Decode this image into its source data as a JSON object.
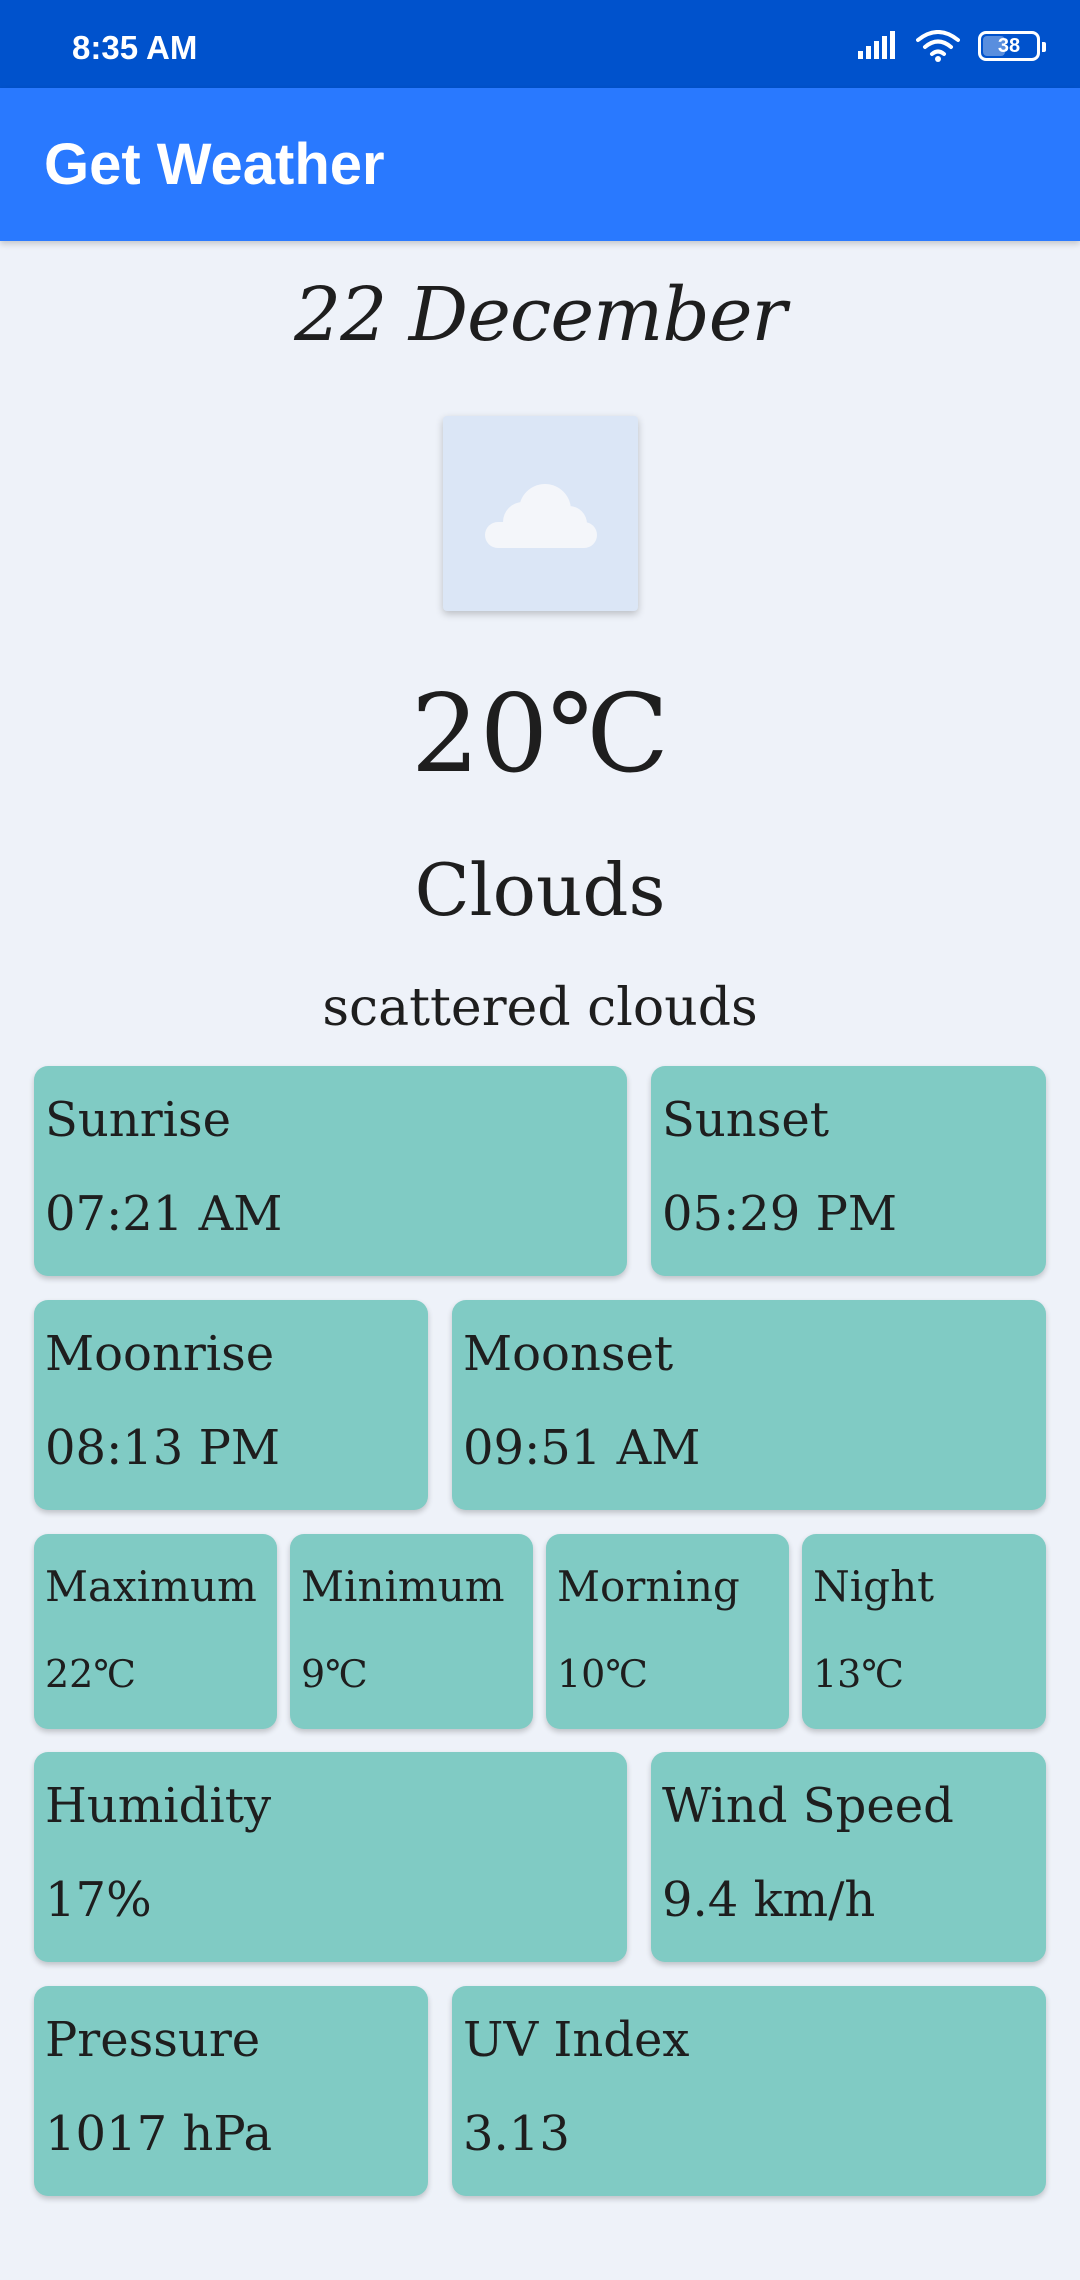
{
  "status_bar": {
    "time": "8:35 AM",
    "battery": "38",
    "icons": [
      "signal-icon",
      "wifi-icon",
      "battery-icon"
    ]
  },
  "app_bar": {
    "title": "Get Weather"
  },
  "weather": {
    "date": "22 December",
    "icon": "cloud-icon",
    "temperature": "20℃",
    "main": "Clouds",
    "description": "scattered clouds"
  },
  "cards": {
    "sunrise": {
      "label": "Sunrise",
      "value": "07:21 AM"
    },
    "sunset": {
      "label": "Sunset",
      "value": "05:29 PM"
    },
    "moonrise": {
      "label": "Moonrise",
      "value": "08:13 PM"
    },
    "moonset": {
      "label": "Moonset",
      "value": "09:51 AM"
    },
    "maximum": {
      "label": "Maximum",
      "value": "22℃"
    },
    "minimum": {
      "label": "Minimum",
      "value": "9℃"
    },
    "morning": {
      "label": "Morning",
      "value": "10℃"
    },
    "night": {
      "label": "Night",
      "value": "13℃"
    },
    "humidity": {
      "label": "Humidity",
      "value": "17%"
    },
    "wind_speed": {
      "label": "Wind Speed",
      "value": "9.4 km/h"
    },
    "pressure": {
      "label": "Pressure",
      "value": "1017 hPa"
    },
    "uv_index": {
      "label": "UV Index",
      "value": "3.13"
    }
  },
  "colors": {
    "status_bar": "#0052cc",
    "app_bar": "#2979ff",
    "background": "#eef2f9",
    "card": "#80cbc4",
    "icon_box": "#dbe6f6"
  }
}
